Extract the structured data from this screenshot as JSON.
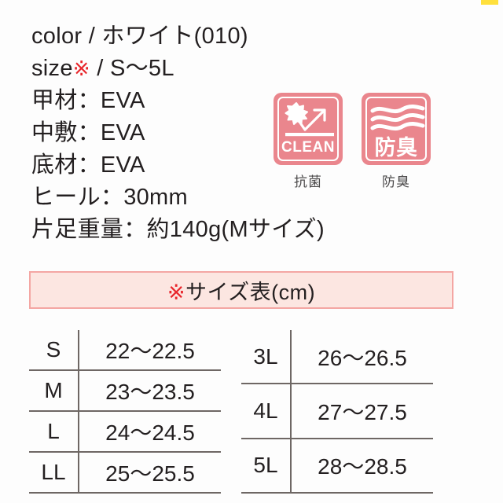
{
  "page": {
    "background_color": "#fdfdfd",
    "accent_pink": "#ea868d",
    "band_fill": "#fce6e1",
    "band_border": "#f4a6a3",
    "kome_red": "#e8262b",
    "yellow_tab_color": "#ffe03d",
    "text_color": "#231f20"
  },
  "spec": {
    "lines": [
      {
        "id": "color",
        "text": "color / ホワイト(010)"
      },
      {
        "id": "size",
        "prefix": "size",
        "kome": "※",
        "suffix": " / S〜5L"
      },
      {
        "id": "upper",
        "text": "甲材：EVA"
      },
      {
        "id": "insole",
        "text": "中敷：EVA"
      },
      {
        "id": "sole",
        "text": "底材：EVA"
      },
      {
        "id": "heel",
        "text": "ヒール：30mm"
      },
      {
        "id": "weight",
        "text": "片足重量：約140g(Mサイズ)"
      }
    ]
  },
  "badges": [
    {
      "id": "antibacterial",
      "icon": "clean-burst-arrow-icon",
      "word": "CLEAN",
      "caption": "抗菌",
      "script": "latin"
    },
    {
      "id": "deodorant",
      "icon": "air-wave-lines-icon",
      "word": "防臭",
      "caption": "防臭",
      "script": "cjk"
    }
  ],
  "size_table": {
    "header": {
      "kome": "※",
      "text": "サイズ表(cm)"
    },
    "left": [
      {
        "size": "S",
        "range": "22〜22.5"
      },
      {
        "size": "M",
        "range": "23〜23.5"
      },
      {
        "size": "L",
        "range": "24〜24.5"
      },
      {
        "size": "LL",
        "range": "25〜25.5"
      }
    ],
    "right": [
      {
        "size": "3L",
        "range": "26〜26.5"
      },
      {
        "size": "4L",
        "range": "27〜27.5"
      },
      {
        "size": "5L",
        "range": "28〜28.5"
      }
    ]
  }
}
